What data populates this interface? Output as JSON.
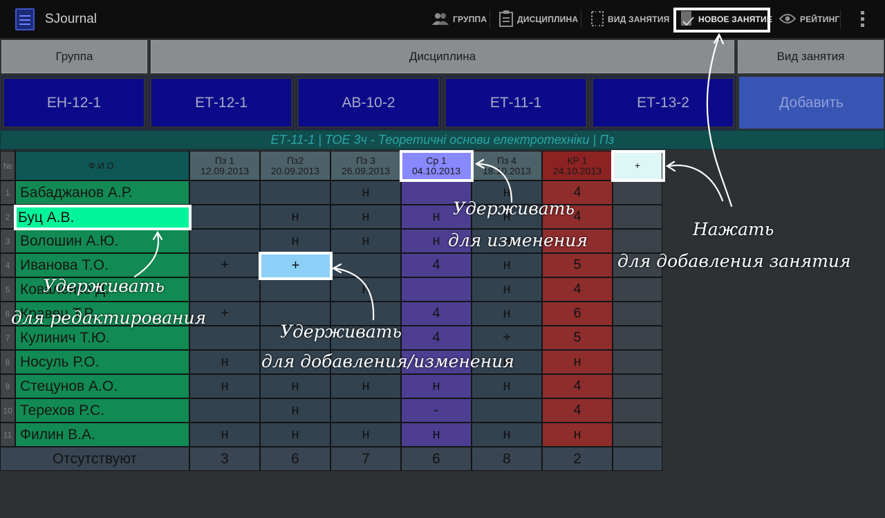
{
  "app": {
    "title": "SJournal"
  },
  "actionbar": {
    "items": [
      {
        "label": "ГРУППА",
        "icon": "group-icon"
      },
      {
        "label": "ДИСЦИПЛИНА",
        "icon": "clipboard-icon"
      },
      {
        "label": "ВИД ЗАНЯТИЯ",
        "icon": "lesson-type-icon"
      },
      {
        "label": "НОВОЕ ЗАНЯТИЕ",
        "icon": "checkmark-icon"
      },
      {
        "label": "РЕЙТИНГ",
        "icon": "eye-icon"
      }
    ]
  },
  "header": {
    "group": "Группа",
    "discipline": "Дисциплина",
    "lesson_type": "Вид занятия"
  },
  "groups": [
    "ЕН-12-1",
    "ЕТ-12-1",
    "АВ-10-2",
    "ЕТ-11-1",
    "ЕТ-13-2"
  ],
  "add_button": "Добавить",
  "info_bar": "ЕТ-11-1  |  ТОЕ 3ч - Теоретичні основи електротехніки  |  Пз",
  "table": {
    "num_header": "№",
    "name_header": "Ф.И.О.",
    "add_column": "+",
    "columns": [
      {
        "title": "Пз 1",
        "date": "12.09.2013",
        "style": "normal"
      },
      {
        "title": "Пз2",
        "date": "20.09.2013",
        "style": "normal"
      },
      {
        "title": "Пз 3",
        "date": "26.09.2013",
        "style": "normal"
      },
      {
        "title": "Ср 1",
        "date": "04.10.2013",
        "style": "purple"
      },
      {
        "title": "Пз 4",
        "date": "18.10.2013",
        "style": "normal"
      },
      {
        "title": "КР 1",
        "date": "24.10.2013",
        "style": "red"
      }
    ],
    "rows": [
      {
        "n": "1",
        "name": "Бабаджанов А.Р.",
        "marks": [
          "",
          "",
          "н",
          "",
          "н",
          "4"
        ]
      },
      {
        "n": "2",
        "name": "Буц А.В.",
        "marks": [
          "",
          "н",
          "н",
          "н",
          "н",
          "4"
        ]
      },
      {
        "n": "3",
        "name": "Волошин А.Ю.",
        "marks": [
          "",
          "н",
          "н",
          "н",
          "н",
          ""
        ]
      },
      {
        "n": "4",
        "name": "Иванова Т.О.",
        "marks": [
          "+",
          "+",
          "",
          "4",
          "н",
          "5"
        ]
      },
      {
        "n": "5",
        "name": "Коваленко Д.",
        "marks": [
          "",
          "",
          "н",
          "",
          "н",
          "4"
        ]
      },
      {
        "n": "6",
        "name": "Кравец Т.Р.",
        "marks": [
          "+",
          "",
          "",
          "4",
          "н",
          "6"
        ]
      },
      {
        "n": "7",
        "name": "Кулинич Т.Ю.",
        "marks": [
          "",
          "",
          "",
          "4",
          "+",
          "5"
        ]
      },
      {
        "n": "8",
        "name": "Носуль Р.О.",
        "marks": [
          "н",
          "",
          "",
          "",
          "н",
          "н"
        ]
      },
      {
        "n": "9",
        "name": "Стецунов А.О.",
        "marks": [
          "н",
          "н",
          "н",
          "н",
          "н",
          "4"
        ]
      },
      {
        "n": "10",
        "name": "Терехов Р.С.",
        "marks": [
          "",
          "н",
          "",
          "-",
          "",
          "4"
        ]
      },
      {
        "n": "11",
        "name": "Филин В.А.",
        "marks": [
          "н",
          "н",
          "н",
          "н",
          "н",
          "н"
        ]
      }
    ],
    "totals_label": "Отсутствуют",
    "totals": [
      "3",
      "6",
      "7",
      "6",
      "8",
      "2"
    ]
  },
  "annotations": {
    "hold_change_1": "Удерживать",
    "hold_change_2": "для изменения",
    "press_1": "Нажать",
    "press_2": "для добавления занятия",
    "hold_edit_1": "Удерживать",
    "hold_edit_2": "для редактирования",
    "hold_add_1": "Удерживать",
    "hold_add_2": "для добавления/изменения"
  },
  "colors": {
    "name_cell": "#118b53",
    "selected_name": "#00f59a",
    "group_tile": "#0b0b8a",
    "add_tile": "#3955b4",
    "purple_col": "#4d3e92",
    "red_col": "#8f2d2d"
  }
}
